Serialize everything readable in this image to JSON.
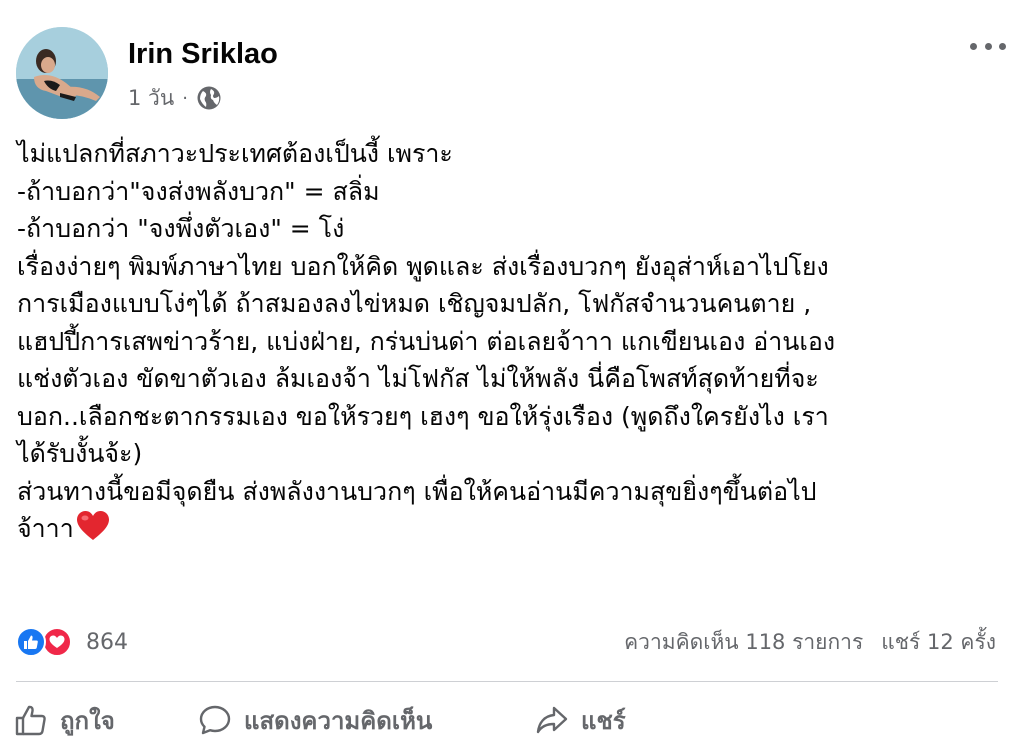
{
  "post": {
    "author": "Irin Sriklao",
    "time": "1 วัน",
    "separator": "·",
    "audience_icon": "globe-icon",
    "more_icon": "more-options-icon",
    "lines": [
      "ไม่แปลกที่สภาวะประเทศต้องเป็นงี้ เพราะ",
      "-ถ้าบอกว่า\"จงส่งพลังบวก\" = สลิ่ม",
      "-ถ้าบอกว่า \"จงพึ่งตัวเอง\" = โง่",
      "เรื่องง่ายๆ พิมพ์ภาษาไทย บอกให้คิด พูดและ ส่งเรื่องบวกๆ ยังอุส่าห์เอาไปโยง",
      "การเมืองแบบโง่ๆได้ ถ้าสมองลงไข่หมด เชิญจมปลัก, โฟกัสจำนวนคนตาย ,",
      "แฮปปี้การเสพข่าวร้าย, แบ่งฝ่าย, กร่นบ่นด่า ต่อเลยจ้าาา แกเขียนเอง อ่านเอง",
      "แช่งตัวเอง  ขัดขาตัวเอง ล้มเองจ้า ไม่โฟกัส ไม่ให้พลัง นี่คือโพสท์สุดท้ายที่จะ",
      "บอก..เลือกชะตากรรมเอง ขอให้รวยๆ เฮงๆ ขอให้รุ่งเรือง (พูดถึงใครยังไง เรา",
      "ได้รับงั้นจ้ะ)",
      "ส่วนทางนี้ขอมีจุดยืน ส่งพลังงานบวกๆ เพื่อให้คนอ่านมีความสุขยิ่งๆขึ้นต่อไป",
      "จ้าาา"
    ]
  },
  "reactions": {
    "icons": [
      "like-reaction-icon",
      "love-reaction-icon"
    ],
    "count": "864",
    "comments": "ความคิดเห็น 118 รายการ",
    "shares": "แชร์ 12 ครั้ง"
  },
  "actions": {
    "like_label": "ถูกใจ",
    "comment_label": "แสดงความคิดเห็น",
    "share_label": "แชร์"
  },
  "colors": {
    "text": "#050505",
    "secondary": "#65676b",
    "like_blue": "#1877f2",
    "love_red": "#f02849",
    "heart_emoji": "#e3262f",
    "divider": "#ced0d4"
  }
}
